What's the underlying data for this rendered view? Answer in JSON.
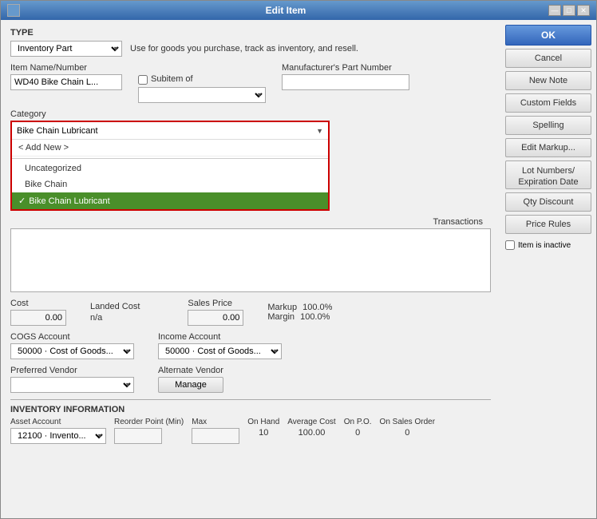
{
  "window": {
    "title": "Edit Item",
    "title_bar_icon": "edit-item-icon",
    "controls": {
      "minimize": "—",
      "maximize": "□",
      "close": "✕"
    }
  },
  "type_section": {
    "label": "TYPE",
    "value": "Inventory Part",
    "description": "Use for goods you purchase, track as inventory, and resell."
  },
  "item_name": {
    "label": "Item Name/Number",
    "value": "WD40 Bike Chain L...",
    "subitem_label": "Subitem of",
    "manufacturer_label": "Manufacturer's Part Number",
    "manufacturer_value": ""
  },
  "category": {
    "label": "Category",
    "selected": "Bike Chain Lubricant",
    "add_new": "< Add New >",
    "options": [
      {
        "id": "uncategorized",
        "label": "Uncategorized",
        "selected": false
      },
      {
        "id": "bike-chain",
        "label": "Bike Chain",
        "selected": false
      },
      {
        "id": "bike-chain-lubricant",
        "label": "Bike Chain Lubricant",
        "selected": true
      }
    ]
  },
  "transactions": {
    "label": "Transactions"
  },
  "cost": {
    "label": "Cost",
    "value": "0.00"
  },
  "landed_cost": {
    "label": "Landed Cost",
    "value": "n/a"
  },
  "sales_price": {
    "label": "Sales Price",
    "value": "0.00",
    "markup_label": "Markup",
    "markup_value": "100.0%",
    "margin_label": "Margin",
    "margin_value": "100.0%"
  },
  "cogs_account": {
    "label": "COGS Account",
    "value": "50000 · Cost of Goods..."
  },
  "income_account": {
    "label": "Income Account",
    "value": "50000 · Cost of Goods..."
  },
  "preferred_vendor": {
    "label": "Preferred Vendor",
    "value": ""
  },
  "alternate_vendor": {
    "label": "Alternate Vendor",
    "manage_label": "Manage"
  },
  "inventory_section": {
    "title": "INVENTORY INFORMATION",
    "asset_account_label": "Asset Account",
    "asset_account_value": "12100 · Invento...",
    "reorder_point_label": "Reorder Point (Min)",
    "max_label": "Max",
    "on_hand_label": "On Hand",
    "on_hand_value": "10",
    "average_cost_label": "Average Cost",
    "average_cost_value": "100.00",
    "on_po_label": "On P.O.",
    "on_po_value": "0",
    "on_sales_order_label": "On Sales Order",
    "on_sales_order_value": "0"
  },
  "right_panel": {
    "ok_label": "OK",
    "cancel_label": "Cancel",
    "new_note_label": "New Note",
    "custom_fields_label": "Custom Fields",
    "spelling_label": "Spelling",
    "edit_markup_label": "Edit Markup...",
    "lot_numbers_label": "Lot Numbers/ Expiration Date",
    "qty_discount_label": "Qty Discount",
    "price_rules_label": "Price Rules"
  },
  "item_inactive": {
    "label": "Item is inactive",
    "checked": false
  }
}
